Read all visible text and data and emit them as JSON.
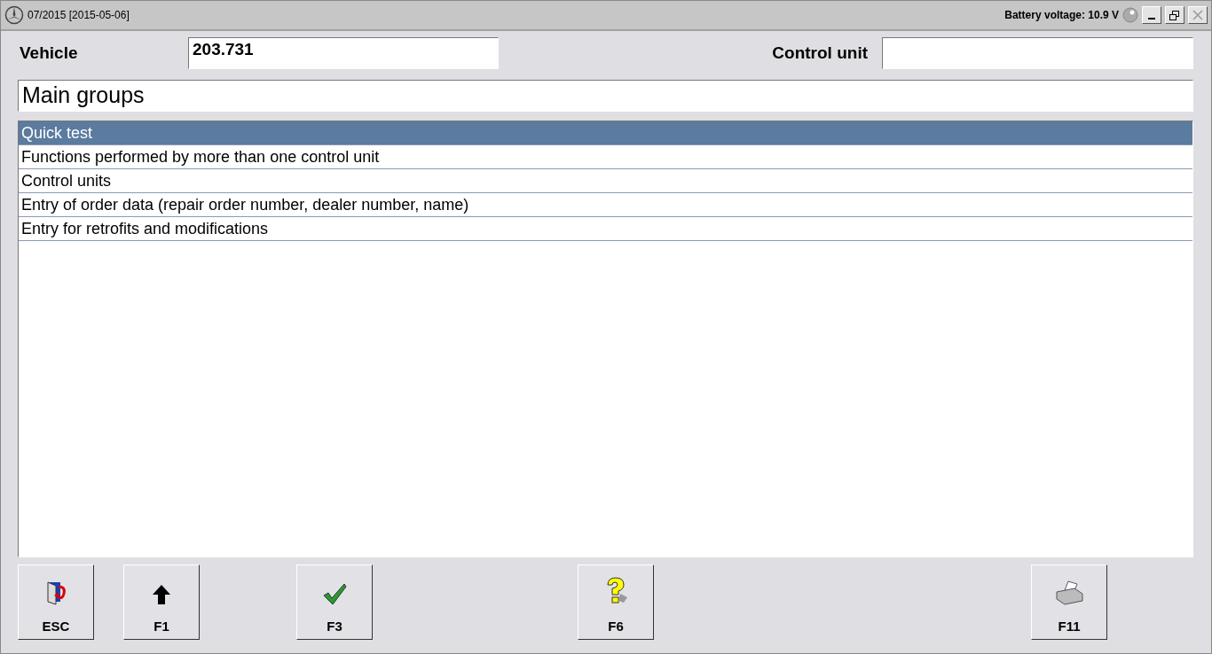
{
  "window": {
    "title": "07/2015 [2015-05-06]",
    "battery": "Battery voltage: 10.9 V"
  },
  "vehicle": {
    "label": "Vehicle",
    "value": "203.731"
  },
  "control_unit": {
    "label": "Control unit"
  },
  "heading": "Main groups",
  "items": [
    {
      "label": "Quick test",
      "selected": true
    },
    {
      "label": "Functions performed by more than one control unit",
      "selected": false
    },
    {
      "label": "Control units",
      "selected": false
    },
    {
      "label": "Entry of order data (repair order number, dealer number, name)",
      "selected": false
    },
    {
      "label": "Entry for retrofits and modifications",
      "selected": false
    }
  ],
  "buttons": [
    {
      "kind": "exit",
      "label": "ESC"
    },
    {
      "kind": "up",
      "label": "F1"
    },
    {
      "kind": "ok",
      "label": "F3"
    },
    {
      "kind": "help",
      "label": "F6"
    },
    {
      "kind": "print",
      "label": "F11"
    }
  ]
}
